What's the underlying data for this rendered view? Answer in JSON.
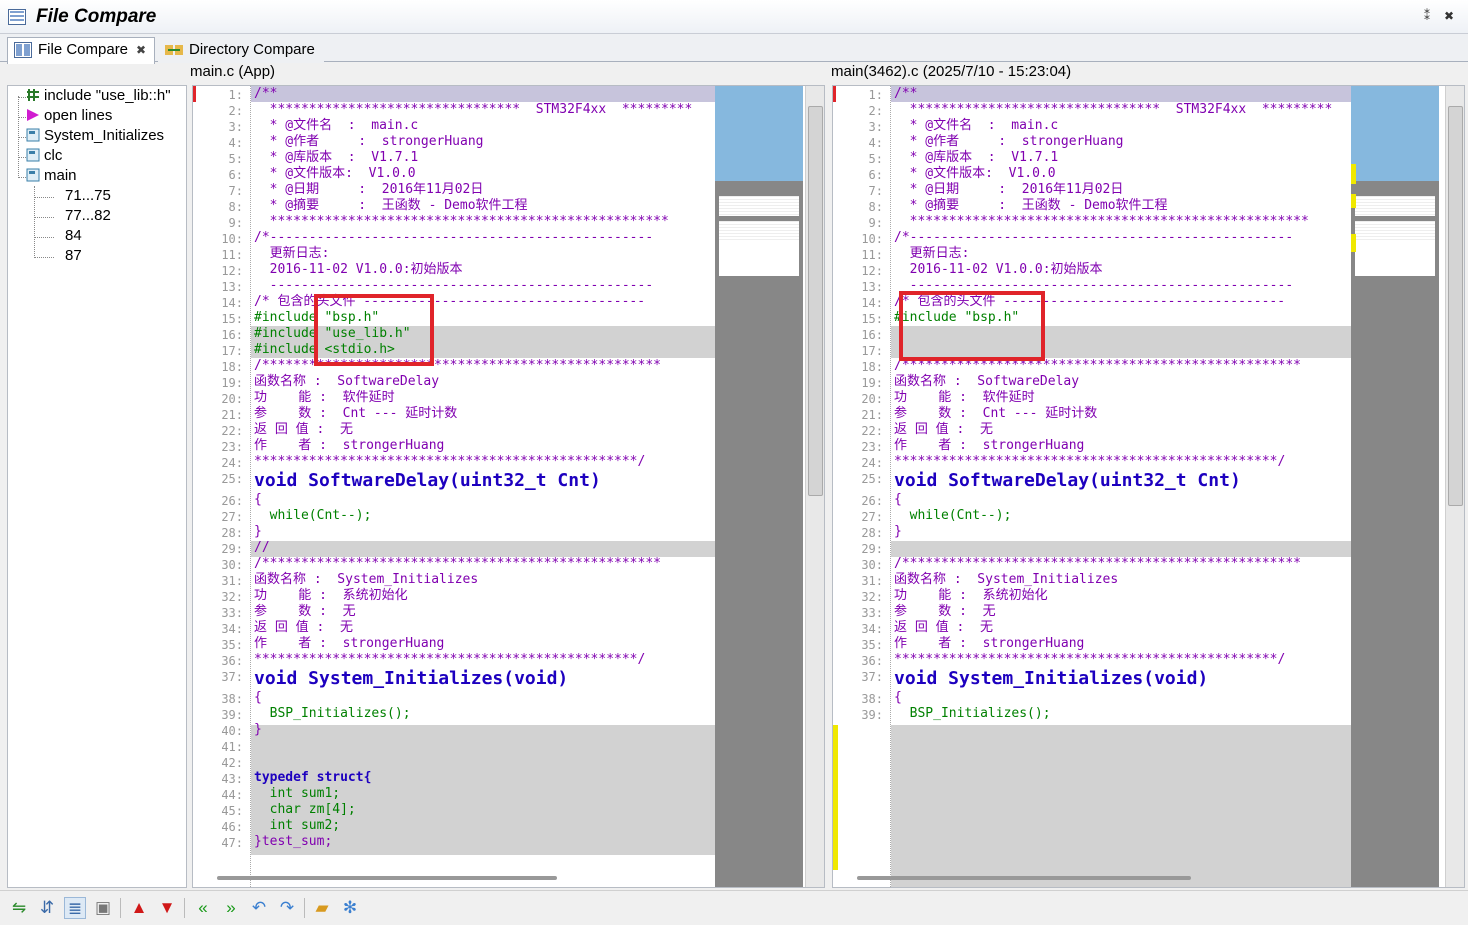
{
  "app": {
    "title": "File Compare",
    "pin": "⁑",
    "close": "✖"
  },
  "tabs": [
    {
      "label": "File Compare",
      "close": "✖"
    },
    {
      "label": "Directory Compare"
    }
  ],
  "left_header": "main.c (App)",
  "right_header": "main(3462).c (2025/7/10 - 15:23:04)",
  "tree": [
    {
      "label": "include \"use_lib::h\"",
      "icon": "include-icon"
    },
    {
      "label": "open lines",
      "icon": "arrow-right-icon"
    },
    {
      "label": "System_Initializes",
      "icon": "function-icon"
    },
    {
      "label": "clc",
      "icon": "function-icon"
    },
    {
      "label": "main",
      "icon": "function-icon"
    },
    {
      "label": "71...75"
    },
    {
      "label": "77...82"
    },
    {
      "label": "84"
    },
    {
      "label": "87"
    }
  ],
  "left_lines": [
    {
      "n": "1:",
      "t": "/**"
    },
    {
      "n": "2:",
      "t": "  ********************************  STM32F4xx  *********"
    },
    {
      "n": "3:",
      "t": "  * @文件名  :  main.c"
    },
    {
      "n": "4:",
      "t": "  * @作者     :  strongerHuang"
    },
    {
      "n": "5:",
      "t": "  * @库版本  :  V1.7.1"
    },
    {
      "n": "6:",
      "t": "  * @文件版本:  V1.0.0"
    },
    {
      "n": "7:",
      "t": "  * @日期     :  2016年11月02日"
    },
    {
      "n": "8:",
      "t": "  * @摘要     :  王函数 - Demo软件工程"
    },
    {
      "n": "9:",
      "t": "  ***************************************************"
    },
    {
      "n": "10:",
      "t": "/*-------------------------------------------------"
    },
    {
      "n": "11:",
      "t": "  更新日志:"
    },
    {
      "n": "12:",
      "t": "  2016-11-02 V1.0.0:初始版本"
    },
    {
      "n": "13:",
      "t": "  -------------------------------------------------"
    },
    {
      "n": "14:",
      "t": "/* 包含的头文件 ------------------------------------"
    },
    {
      "n": "15:",
      "t": "#include \"bsp.h\""
    },
    {
      "n": "16:",
      "t": "#include \"use_lib.h\""
    },
    {
      "n": "17:",
      "t": "#include <stdio.h>"
    },
    {
      "n": "18:",
      "t": "/***************************************************"
    },
    {
      "n": "19:",
      "t": "函数名称 :  SoftwareDelay"
    },
    {
      "n": "20:",
      "t": "功    能 :  软件延时"
    },
    {
      "n": "21:",
      "t": "参    数 :  Cnt --- 延时计数"
    },
    {
      "n": "22:",
      "t": "返 回 值 :  无"
    },
    {
      "n": "23:",
      "t": "作    者 :  strongerHuang"
    },
    {
      "n": "24:",
      "t": "*************************************************/"
    },
    {
      "n": "25:",
      "t": "void SoftwareDelay(uint32_t Cnt)"
    },
    {
      "n": "26:",
      "t": "{"
    },
    {
      "n": "27:",
      "t": "  while(Cnt--);"
    },
    {
      "n": "28:",
      "t": "}"
    },
    {
      "n": "29:",
      "t": "//"
    },
    {
      "n": "30:",
      "t": "/***************************************************"
    },
    {
      "n": "31:",
      "t": "函数名称 :  System_Initializes"
    },
    {
      "n": "32:",
      "t": "功    能 :  系统初始化"
    },
    {
      "n": "33:",
      "t": "参    数 :  无"
    },
    {
      "n": "34:",
      "t": "返 回 值 :  无"
    },
    {
      "n": "35:",
      "t": "作    者 :  strongerHuang"
    },
    {
      "n": "36:",
      "t": "*************************************************/"
    },
    {
      "n": "37:",
      "t": "void System_Initializes(void)"
    },
    {
      "n": "38:",
      "t": "{"
    },
    {
      "n": "39:",
      "t": "  BSP_Initializes();"
    },
    {
      "n": "40:",
      "t": "}"
    },
    {
      "n": "41:",
      "t": ""
    },
    {
      "n": "42:",
      "t": ""
    },
    {
      "n": "43:",
      "t": "typedef struct{"
    },
    {
      "n": "44:",
      "t": "  int sum1;"
    },
    {
      "n": "45:",
      "t": "  char zm[4];"
    },
    {
      "n": "46:",
      "t": "  int sum2;"
    },
    {
      "n": "47:",
      "t": "}test_sum;"
    }
  ],
  "right_lines": [
    {
      "n": "1:",
      "t": "/**"
    },
    {
      "n": "2:",
      "t": "  ********************************  STM32F4xx  *********"
    },
    {
      "n": "3:",
      "t": "  * @文件名  :  main.c"
    },
    {
      "n": "4:",
      "t": "  * @作者     :  strongerHuang"
    },
    {
      "n": "5:",
      "t": "  * @库版本  :  V1.7.1"
    },
    {
      "n": "6:",
      "t": "  * @文件版本:  V1.0.0"
    },
    {
      "n": "7:",
      "t": "  * @日期     :  2016年11月02日"
    },
    {
      "n": "8:",
      "t": "  * @摘要     :  王函数 - Demo软件工程"
    },
    {
      "n": "9:",
      "t": "  ***************************************************"
    },
    {
      "n": "10:",
      "t": "/*-------------------------------------------------"
    },
    {
      "n": "11:",
      "t": "  更新日志:"
    },
    {
      "n": "12:",
      "t": "  2016-11-02 V1.0.0:初始版本"
    },
    {
      "n": "13:",
      "t": "  -------------------------------------------------"
    },
    {
      "n": "14:",
      "t": "/* 包含的头文件 ------------------------------------"
    },
    {
      "n": "15:",
      "t": "#include \"bsp.h\""
    },
    {
      "n": "16:",
      "t": ""
    },
    {
      "n": "17:",
      "t": ""
    },
    {
      "n": "18:",
      "t": "/***************************************************"
    },
    {
      "n": "19:",
      "t": "函数名称 :  SoftwareDelay"
    },
    {
      "n": "20:",
      "t": "功    能 :  软件延时"
    },
    {
      "n": "21:",
      "t": "参    数 :  Cnt --- 延时计数"
    },
    {
      "n": "22:",
      "t": "返 回 值 :  无"
    },
    {
      "n": "23:",
      "t": "作    者 :  strongerHuang"
    },
    {
      "n": "24:",
      "t": "*************************************************/"
    },
    {
      "n": "25:",
      "t": "void SoftwareDelay(uint32_t Cnt)"
    },
    {
      "n": "26:",
      "t": "{"
    },
    {
      "n": "27:",
      "t": "  while(Cnt--);"
    },
    {
      "n": "28:",
      "t": "}"
    },
    {
      "n": "29:",
      "t": ""
    },
    {
      "n": "30:",
      "t": "/***************************************************"
    },
    {
      "n": "31:",
      "t": "函数名称 :  System_Initializes"
    },
    {
      "n": "32:",
      "t": "功    能 :  系统初始化"
    },
    {
      "n": "33:",
      "t": "参    数 :  无"
    },
    {
      "n": "34:",
      "t": "返 回 值 :  无"
    },
    {
      "n": "35:",
      "t": "作    者 :  strongerHuang"
    },
    {
      "n": "36:",
      "t": "*************************************************/"
    },
    {
      "n": "37:",
      "t": "void System_Initializes(void)"
    },
    {
      "n": "38:",
      "t": "{"
    },
    {
      "n": "39:",
      "t": "  BSP_Initializes();"
    }
  ],
  "toolbar": [
    "sync-icon",
    "swap-files-icon",
    "compare-icon",
    "lock-icon",
    "prev-diff-icon",
    "next-diff-icon",
    "first-diff-icon",
    "last-diff-icon",
    "undo-icon",
    "redo-icon",
    "open-folder-icon",
    "settings-icon"
  ],
  "colors": {
    "diff_bg": "#d2d2d2",
    "red_box": "#e0242a",
    "minimap_view": "#86b8de"
  }
}
